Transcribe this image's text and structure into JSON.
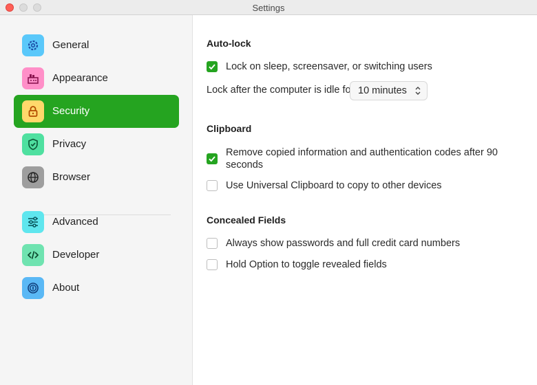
{
  "window": {
    "title": "Settings"
  },
  "sidebar": {
    "items": [
      {
        "label": "General",
        "icon": "gear-icon",
        "color": "#5ac8fa"
      },
      {
        "label": "Appearance",
        "icon": "palette-icon",
        "color": "#ff8fc8"
      },
      {
        "label": "Security",
        "icon": "lock-icon",
        "color": "#ffd86b",
        "active": true
      },
      {
        "label": "Privacy",
        "icon": "shield-icon",
        "color": "#4fe0a0"
      },
      {
        "label": "Browser",
        "icon": "globe-icon",
        "color": "#9e9e9e"
      },
      {
        "label": "Advanced",
        "icon": "sliders-icon",
        "color": "#5fe6ee"
      },
      {
        "label": "Developer",
        "icon": "code-icon",
        "color": "#6fe3b0"
      },
      {
        "label": "About",
        "icon": "info-icon",
        "color": "#5ab8f5"
      }
    ],
    "active_color": "#25a420"
  },
  "sections": {
    "autolock": {
      "title": "Auto-lock",
      "lock_on_sleep": {
        "label": "Lock on sleep, screensaver, or switching users",
        "checked": true
      },
      "idle_label": "Lock after the computer is idle for",
      "idle_value": "10 minutes"
    },
    "clipboard": {
      "title": "Clipboard",
      "remove_copied": {
        "label_line1": "Remove copied information and authentication codes after 90",
        "label_line2": "seconds",
        "checked": true
      },
      "universal": {
        "label": "Use Universal Clipboard to copy to other devices",
        "checked": false
      }
    },
    "concealed": {
      "title": "Concealed Fields",
      "always_show": {
        "label": "Always show passwords and full credit card numbers",
        "checked": false
      },
      "hold_option": {
        "label": "Hold Option to toggle revealed fields",
        "checked": false
      }
    }
  }
}
